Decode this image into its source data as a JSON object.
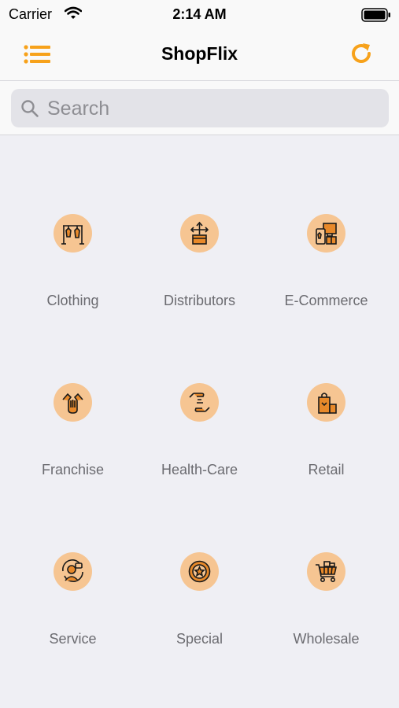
{
  "status": {
    "carrier": "Carrier",
    "time": "2:14 AM"
  },
  "header": {
    "title": "ShopFlix",
    "menu_icon": "list-icon",
    "refresh_icon": "refresh-icon",
    "accent": "#f7a21b"
  },
  "search": {
    "placeholder": "Search",
    "value": ""
  },
  "categories": [
    {
      "label": "Clothing",
      "icon": "clothing-rack-icon"
    },
    {
      "label": "Distributors",
      "icon": "distribution-box-icon"
    },
    {
      "label": "E-Commerce",
      "icon": "ecommerce-store-icon"
    },
    {
      "label": "Franchise",
      "icon": "handshake-icon"
    },
    {
      "label": "Health-Care",
      "icon": "caring-hands-icon"
    },
    {
      "label": "Retail",
      "icon": "shopping-bag-icon"
    },
    {
      "label": "Service",
      "icon": "customer-service-icon"
    },
    {
      "label": "Special",
      "icon": "star-badge-icon"
    },
    {
      "label": "Wholesale",
      "icon": "shopping-cart-icon"
    }
  ]
}
